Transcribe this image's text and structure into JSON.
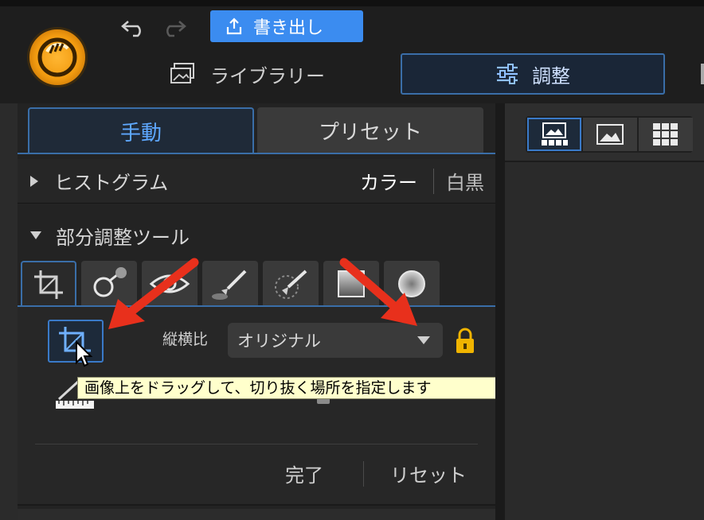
{
  "header": {
    "export_label": "書き出し",
    "library_label": "ライブラリー",
    "adjust_label": "調整"
  },
  "panel": {
    "tabs": {
      "manual": "手動",
      "preset": "プリセット"
    },
    "histogram": {
      "title": "ヒストグラム",
      "color": "カラー",
      "mono": "白黒"
    },
    "local_tools": {
      "title": "部分調整ツール",
      "tools": [
        "crop-icon",
        "spot-heal-icon",
        "red-eye-icon",
        "brush-icon",
        "gradient-brush-icon",
        "linear-gradient-icon",
        "radial-gradient-icon"
      ]
    },
    "crop": {
      "aspect_label": "縦横比",
      "aspect_value": "オリジナル",
      "tooltip": "画像上をドラッグして、切り抜く場所を指定します",
      "done": "完了",
      "reset": "リセット"
    }
  },
  "colors": {
    "accent": "#3a6ea8",
    "export_button": "#3b8cf0",
    "arrow": "#e8301c",
    "lock": "#f0b400"
  }
}
